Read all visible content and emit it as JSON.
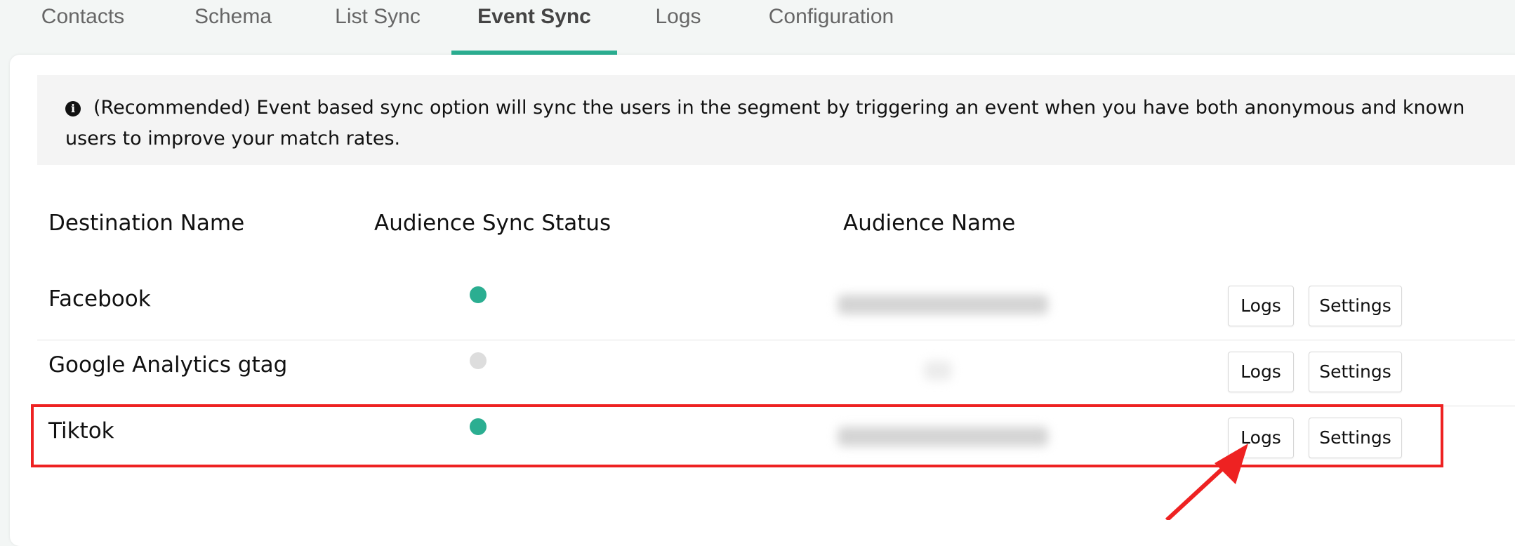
{
  "tabs": [
    {
      "label": "Contacts",
      "active": false
    },
    {
      "label": "Schema",
      "active": false
    },
    {
      "label": "List Sync",
      "active": false
    },
    {
      "label": "Event Sync",
      "active": true
    },
    {
      "label": "Logs",
      "active": false
    },
    {
      "label": "Configuration",
      "active": false
    }
  ],
  "info": {
    "icon": "info-icon",
    "text": "(Recommended) Event based sync option will sync the users in the segment by triggering an event when you have both anonymous and known users to improve your match rates."
  },
  "table": {
    "headers": {
      "destination": "Destination Name",
      "status": "Audience Sync Status",
      "audience": "Audience Name"
    },
    "rows": [
      {
        "destination": "Facebook",
        "status": "active",
        "status_color": "#2bae91",
        "audience": "redacted",
        "logs_label": "Logs",
        "settings_label": "Settings"
      },
      {
        "destination": "Google Analytics gtag",
        "status": "inactive",
        "status_color": "#dddddd",
        "audience": "redacted",
        "logs_label": "Logs",
        "settings_label": "Settings"
      },
      {
        "destination": "Tiktok",
        "status": "active",
        "status_color": "#2bae91",
        "audience": "redacted",
        "logs_label": "Logs",
        "settings_label": "Settings"
      }
    ]
  },
  "annotation": {
    "highlight_color": "#ee2222",
    "highlighted_row": "Tiktok",
    "arrow_target": "Logs"
  },
  "colors": {
    "accent": "#2bae91"
  }
}
